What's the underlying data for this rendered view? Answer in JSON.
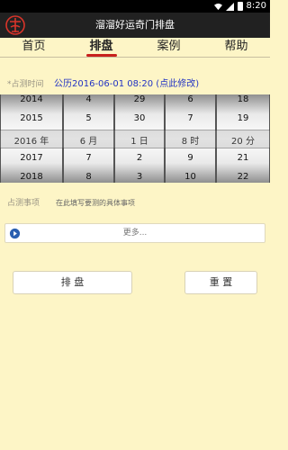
{
  "status": {
    "time": "8:20"
  },
  "app": {
    "title": "溜溜好运奇门排盘",
    "logo_char": "奇"
  },
  "tabs": [
    {
      "label": "首页"
    },
    {
      "label": "排盘"
    },
    {
      "label": "案例"
    },
    {
      "label": "帮助"
    }
  ],
  "active_tab": "排盘",
  "time_section": {
    "label": "*占测时间",
    "value": "公历2016-06-01 08:20 (点此修改)"
  },
  "picker": {
    "year": {
      "items": [
        "2014",
        "2015",
        "2016  年",
        "2017",
        "2018"
      ]
    },
    "month": {
      "items": [
        "4",
        "5",
        "6  月",
        "7",
        "8"
      ]
    },
    "day": {
      "items": [
        "29",
        "30",
        "1  日",
        "2",
        "3"
      ]
    },
    "hour": {
      "items": [
        "6",
        "7",
        "8  时",
        "9",
        "10"
      ]
    },
    "minute": {
      "items": [
        "18",
        "19",
        "20  分",
        "21",
        "22"
      ]
    }
  },
  "note_section": {
    "label": "占测事项",
    "placeholder": "在此填写要测的具体事项"
  },
  "more": {
    "label": "更多..."
  },
  "buttons": {
    "paipan": "排      盘",
    "reset": "重    置"
  },
  "colors": {
    "background": "#fdf5c6",
    "titlebar": "#212121",
    "accent_red": "#c8201c",
    "link_blue": "#2233c4",
    "more_icon_blue": "#2a5fb0"
  }
}
